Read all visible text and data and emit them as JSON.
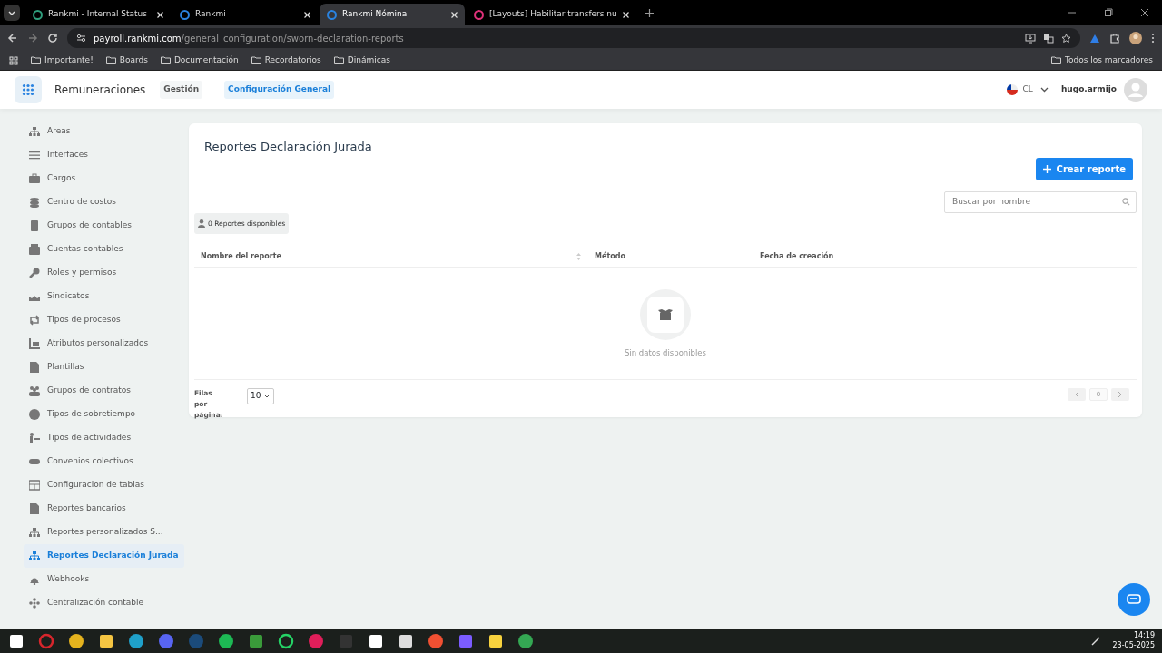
{
  "browser": {
    "tabs": [
      {
        "title": "Rankmi - Internal Status",
        "selected": false
      },
      {
        "title": "Rankmi",
        "selected": false
      },
      {
        "title": "Rankmi Nómina",
        "selected": true
      },
      {
        "title": "[Layouts] Habilitar transfers nu",
        "selected": false
      }
    ],
    "url": {
      "domain": "payroll.rankmi.com",
      "path": "/general_configuration/sworn-declaration-reports"
    },
    "bookmarks": [
      "Importante!",
      "Boards",
      "Documentación",
      "Recordatorios",
      "Dinámicas"
    ],
    "all_bookmarks": "Todos los marcadores"
  },
  "app": {
    "title": "Remuneraciones",
    "nav": [
      {
        "label": "Gestión",
        "selected": false
      },
      {
        "label": "Configuración General",
        "selected": true
      }
    ],
    "country": "CL",
    "user": "hugo.armijo"
  },
  "sidebar": {
    "items": [
      {
        "label": "Areas",
        "selected": false
      },
      {
        "label": "Interfaces",
        "selected": false
      },
      {
        "label": "Cargos",
        "selected": false
      },
      {
        "label": "Centro de costos",
        "selected": false
      },
      {
        "label": "Grupos de contables",
        "selected": false
      },
      {
        "label": "Cuentas contables",
        "selected": false
      },
      {
        "label": "Roles y permisos",
        "selected": false
      },
      {
        "label": "Sindicatos",
        "selected": false
      },
      {
        "label": "Tipos de procesos",
        "selected": false
      },
      {
        "label": "Atributos personalizados",
        "selected": false
      },
      {
        "label": "Plantillas",
        "selected": false
      },
      {
        "label": "Grupos de contratos",
        "selected": false
      },
      {
        "label": "Tipos de sobretiempo",
        "selected": false
      },
      {
        "label": "Tipos de actividades",
        "selected": false
      },
      {
        "label": "Convenios colectivos",
        "selected": false
      },
      {
        "label": "Configuracion de tablas",
        "selected": false
      },
      {
        "label": "Reportes bancarios",
        "selected": false
      },
      {
        "label": "Reportes personalizados S...",
        "selected": false
      },
      {
        "label": "Reportes Declaración Jurada",
        "selected": true
      },
      {
        "label": "Webhooks",
        "selected": false
      },
      {
        "label": "Centralización contable",
        "selected": false
      }
    ]
  },
  "page": {
    "title": "Reportes Declaración Jurada",
    "create_button": "Crear reporte",
    "search": {
      "placeholder": "Buscar por nombre"
    },
    "count": "0 Reportes disponibles",
    "table": {
      "columns": [
        "Nombre del reporte",
        "Método",
        "Fecha de creación"
      ],
      "empty": "Sin datos disponibles"
    },
    "pagination": {
      "rows_label": "Filas por página:",
      "page_size": "10",
      "page": "0"
    }
  },
  "taskbar": {
    "time": "14:19",
    "date": "23-05-2025"
  }
}
